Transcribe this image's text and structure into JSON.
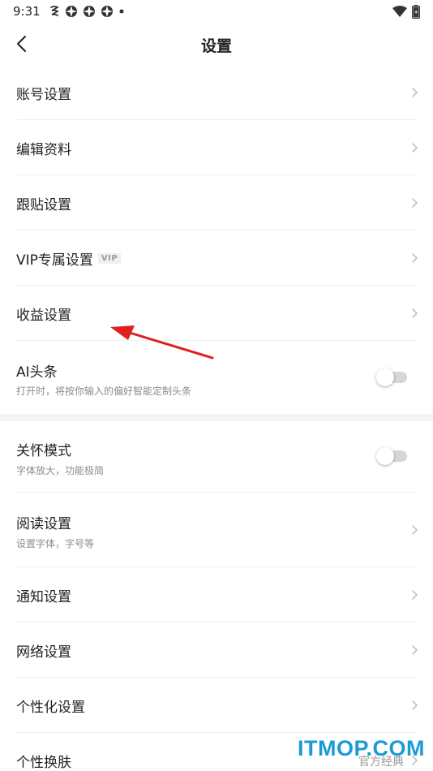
{
  "status_bar": {
    "time": "9:31",
    "left_icons": [
      "notification-app-icon",
      "app-icon-1",
      "app-icon-2",
      "app-icon-3",
      "dot-icon"
    ],
    "right_icons": [
      "wifi-icon",
      "battery-icon"
    ]
  },
  "header": {
    "title": "设置",
    "back_icon": "chevron-left-icon"
  },
  "settings": {
    "account": {
      "label": "账号设置"
    },
    "edit_profile": {
      "label": "编辑资料"
    },
    "follow_post": {
      "label": "跟贴设置"
    },
    "vip": {
      "label": "VIP专属设置",
      "badge": "VIP"
    },
    "earnings": {
      "label": "收益设置"
    },
    "ai_headline": {
      "label": "AI头条",
      "sub": "打开时，将按你输入的偏好智能定制头条",
      "enabled": false
    },
    "care_mode": {
      "label": "关怀模式",
      "sub": "字体放大，功能极简",
      "enabled": false
    },
    "reading": {
      "label": "阅读设置",
      "sub": "设置字体，字号等"
    },
    "notification": {
      "label": "通知设置"
    },
    "network": {
      "label": "网络设置"
    },
    "personalization": {
      "label": "个性化设置"
    },
    "skin": {
      "label": "个性换肤",
      "value": "官方经典"
    }
  },
  "annotation": {
    "color": "#e02020"
  },
  "watermark": {
    "text": "ITMOP.COM",
    "color": "#1b9bd6"
  }
}
